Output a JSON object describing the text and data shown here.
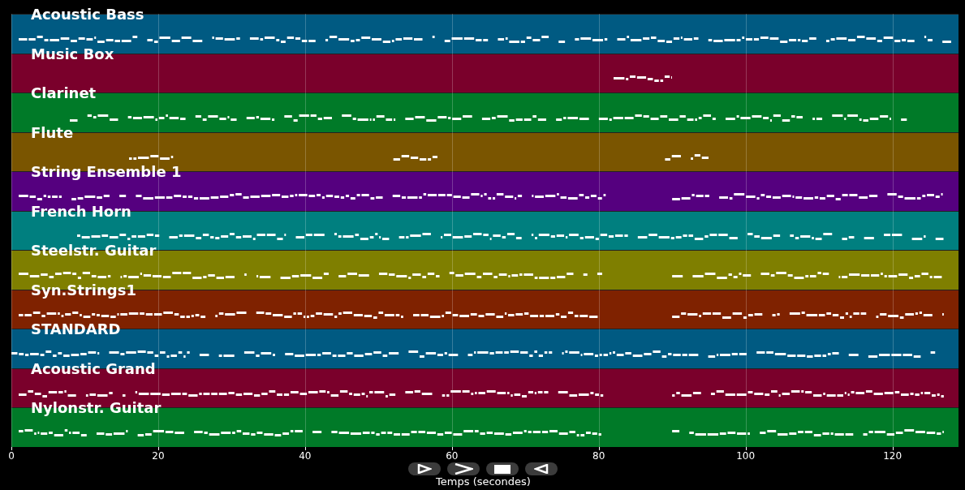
{
  "tracks": [
    {
      "name": "Acoustic Bass",
      "color": "#005a82"
    },
    {
      "name": "Music Box",
      "color": "#7a002b"
    },
    {
      "name": "Clarinet",
      "color": "#007a28"
    },
    {
      "name": "Flute",
      "color": "#7a5500"
    },
    {
      "name": "String Ensemble 1",
      "color": "#55007f"
    },
    {
      "name": "French Horn",
      "color": "#007f7f"
    },
    {
      "name": "Steelstr. Guitar",
      "color": "#7f7f00"
    },
    {
      "name": "Syn.Strings1",
      "color": "#7f2200"
    },
    {
      "name": "STANDARD",
      "color": "#005a82"
    },
    {
      "name": "Acoustic Grand",
      "color": "#7a002b"
    },
    {
      "name": "Nylonstr. Guitar",
      "color": "#007a28"
    }
  ],
  "x_axis": {
    "label": "Temps (secondes)",
    "ticks": [
      "0",
      "20",
      "40",
      "60",
      "80",
      "100",
      "120"
    ]
  },
  "controls": [
    {
      "kind": "play"
    },
    {
      "kind": "forward"
    },
    {
      "kind": "stop"
    },
    {
      "kind": "back"
    }
  ]
}
